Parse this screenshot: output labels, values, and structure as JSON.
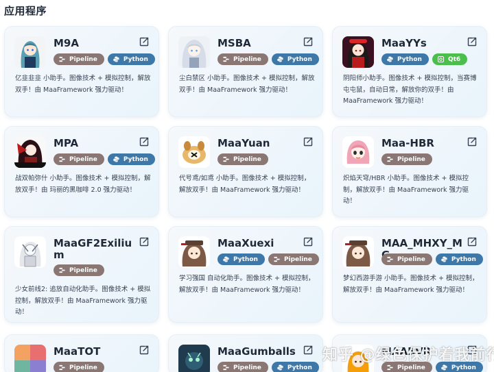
{
  "section": {
    "title": "应用程序"
  },
  "cards": [
    {
      "name": "M9A",
      "avatar_icon": "m9a-avatar",
      "tags": [
        {
          "label": "Pipeline",
          "type": "pipeline"
        },
        {
          "label": "Python",
          "type": "python"
        }
      ],
      "description": "亿韭韭韭 小助手。图像技术 + 模拟控制，解放双手！由 MaaFramework 强力驱动！"
    },
    {
      "name": "MSBA",
      "avatar_icon": "msba-avatar",
      "tags": [
        {
          "label": "Pipeline",
          "type": "pipeline"
        },
        {
          "label": "Python",
          "type": "python"
        }
      ],
      "description": "尘白禁区 小助手。图像技术 + 模拟控制，解放双手！由 MaaFramework 强力驱动！"
    },
    {
      "name": "MaaYYs",
      "avatar_icon": "maayys-avatar",
      "tags": [
        {
          "label": "Python",
          "type": "python"
        },
        {
          "label": "Qt6",
          "type": "qt6"
        }
      ],
      "description": "阴阳师小助手。图像技术 + 模拟控制，当赛博屯屯鼠，自动日常，解放你的双手！由 MaaFramework 强力驱动！"
    },
    {
      "name": "MPA",
      "avatar_icon": "mpa-avatar",
      "tags": [
        {
          "label": "Pipeline",
          "type": "pipeline"
        },
        {
          "label": "Python",
          "type": "python"
        }
      ],
      "description": "战双帕弥什 小助手。图像技术 + 模拟控制，解放双手！由 玛丽的黑咖啡 2.0 强力驱动！"
    },
    {
      "name": "MaaYuan",
      "avatar_icon": "maayuan-avatar",
      "tags": [
        {
          "label": "Pipeline",
          "type": "pipeline"
        }
      ],
      "description": "代号鸢/如鸢 小助手。图像技术 + 模拟控制，解放双手！由 MaaFramework 强力驱动！"
    },
    {
      "name": "Maa-HBR",
      "avatar_icon": "maa-hbr-avatar",
      "tags": [
        {
          "label": "Pipeline",
          "type": "pipeline"
        }
      ],
      "description": "炽焰天穹/HBR 小助手。图像技术 + 模拟控制，解放双手！由 MaaFramework 强力驱动！"
    },
    {
      "name": "MaaGF2Exilium",
      "avatar_icon": "maagf2exilium-avatar",
      "tags": [
        {
          "label": "Pipeline",
          "type": "pipeline"
        }
      ],
      "description": "少女前线2: 追放自动化助手。图像技术 + 模拟控制，解放双手！由 MaaFramework 强力驱动！"
    },
    {
      "name": "MaaXuexi",
      "avatar_icon": "maaxuexi-avatar",
      "tags": [
        {
          "label": "Python",
          "type": "python"
        },
        {
          "label": "Pipeline",
          "type": "pipeline"
        }
      ],
      "description": "学习强国 自动化助手。图像技术 + 模拟控制，解放双手！由 MaaFramework 强力驱动！"
    },
    {
      "name": "MAA_MHXY_MG",
      "avatar_icon": "maa-mhxy-mg-avatar",
      "tags": [
        {
          "label": "Pipeline",
          "type": "pipeline"
        },
        {
          "label": "Python",
          "type": "python"
        }
      ],
      "description": "梦幻西游手游 小助手。图像技术 + 模拟控制，解放双手！由 MaaFramework 强力驱动！"
    },
    {
      "name": "MaaTOT",
      "avatar_icon": "maatot-avatar",
      "tags": [
        {
          "label": "Pipeline",
          "type": "pipeline"
        }
      ],
      "description": ""
    },
    {
      "name": "MaaGumballs",
      "avatar_icon": "maagumballs-avatar",
      "tags": [
        {
          "label": "Pipeline",
          "type": "pipeline"
        },
        {
          "label": "Python",
          "type": "python"
        }
      ],
      "description": ""
    },
    {
      "name": "MAABVR",
      "avatar_icon": "maabvr-avatar",
      "tags": [
        {
          "label": "Pipeline",
          "type": "pipeline"
        },
        {
          "label": "Python",
          "type": "python"
        }
      ],
      "description": ""
    }
  ],
  "watermark": {
    "text": "知乎 @绿色保护着我前行"
  },
  "colors": {
    "pipeline": "#8a7774",
    "python": "#3d78a8",
    "qt6": "#4bbf4b"
  },
  "icons": {
    "edit": "edit-icon",
    "pipeline_tag": "pipeline-glyph-icon",
    "python_tag": "python-glyph-icon",
    "qt6_tag": "qt6-glyph-icon"
  }
}
